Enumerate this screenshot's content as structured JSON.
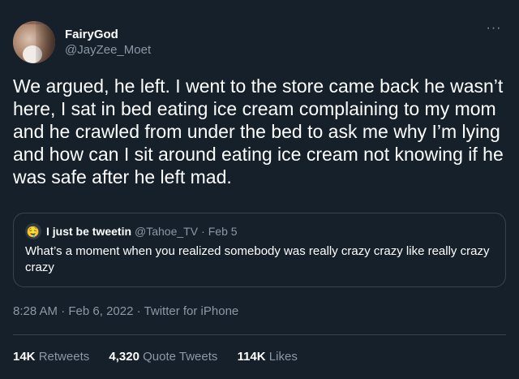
{
  "author": {
    "display_name": "FairyGod",
    "handle": "@JayZee_Moet"
  },
  "tweet_text": "We argued, he left. I went to the store came back he wasn’t here, I sat in bed eating ice cream complaining to my mom and he crawled from under the bed to ask me why I’m lying and how can I sit around eating ice cream not knowing if he was safe after he left mad.",
  "quoted_tweet": {
    "avatar_glyph": "🤤",
    "display_name": "I just be tweetin",
    "handle": "@Tahoe_TV",
    "separator": "·",
    "date": "Feb 5",
    "text": "What’s a moment when you realized somebody was really crazy crazy like really crazy crazy"
  },
  "meta": {
    "time": "8:28 AM",
    "separator": "·",
    "date": "Feb 6, 2022",
    "source": "Twitter for iPhone"
  },
  "stats": {
    "retweets_count": "14K",
    "retweets_label": "Retweets",
    "quotes_count": "4,320",
    "quotes_label": "Quote Tweets",
    "likes_count": "114K",
    "likes_label": "Likes"
  },
  "icons": {
    "more": "more-options-icon"
  },
  "colors": {
    "background": "#15202b",
    "text_primary": "#ffffff",
    "text_secondary": "#8b98a5",
    "border": "#38444d"
  }
}
